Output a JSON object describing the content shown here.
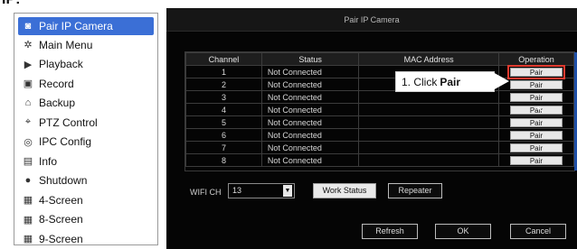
{
  "clipped_header": "IP:",
  "menu": {
    "items": [
      {
        "label": "Pair IP Camera",
        "icon": "camera-icon",
        "glyph": "◙",
        "active": true
      },
      {
        "label": "Main Menu",
        "icon": "gear-icon",
        "glyph": "✲",
        "active": false
      },
      {
        "label": "Playback",
        "icon": "playback-icon",
        "glyph": "▶",
        "active": false
      },
      {
        "label": "Record",
        "icon": "record-icon",
        "glyph": "▣",
        "active": false
      },
      {
        "label": "Backup",
        "icon": "backup-icon",
        "glyph": "⌂",
        "active": false
      },
      {
        "label": "PTZ Control",
        "icon": "ptz-icon",
        "glyph": "⌖",
        "active": false
      },
      {
        "label": "IPC Config",
        "icon": "ipc-config-icon",
        "glyph": "◎",
        "active": false
      },
      {
        "label": "Info",
        "icon": "info-icon",
        "glyph": "▤",
        "active": false
      },
      {
        "label": "Shutdown",
        "icon": "shutdown-icon",
        "glyph": "●",
        "active": false
      },
      {
        "label": "4-Screen",
        "icon": "grid-icon",
        "glyph": "▦",
        "active": false
      },
      {
        "label": "8-Screen",
        "icon": "grid-icon",
        "glyph": "▦",
        "active": false
      },
      {
        "label": "9-Screen",
        "icon": "grid-icon",
        "glyph": "▦",
        "active": false
      }
    ]
  },
  "dialog": {
    "title": "Pair IP Camera",
    "columns": [
      "Channel",
      "Status",
      "MAC Address",
      "Operation"
    ],
    "rows": [
      {
        "channel": "1",
        "status": "Not Connected",
        "mac": "",
        "op": "Pair"
      },
      {
        "channel": "2",
        "status": "Not Connected",
        "mac": "",
        "op": "Pair"
      },
      {
        "channel": "3",
        "status": "Not Connected",
        "mac": "",
        "op": "Pair"
      },
      {
        "channel": "4",
        "status": "Not Connected",
        "mac": "",
        "op": "Pair"
      },
      {
        "channel": "5",
        "status": "Not Connected",
        "mac": "",
        "op": "Pair"
      },
      {
        "channel": "6",
        "status": "Not Connected",
        "mac": "",
        "op": "Pair"
      },
      {
        "channel": "7",
        "status": "Not Connected",
        "mac": "",
        "op": "Pair"
      },
      {
        "channel": "8",
        "status": "Not Connected",
        "mac": "",
        "op": "Pair"
      }
    ],
    "wifi_label": "WIFI CH",
    "wifi_value": "13",
    "work_status": "Work Status",
    "repeater": "Repeater",
    "refresh": "Refresh",
    "ok": "OK",
    "cancel": "Cancel"
  },
  "callout": {
    "prefix": "1. Click",
    "bold": "Pair"
  },
  "colors": {
    "highlight": "#e03a2f",
    "active_menu": "#3b6fd6"
  }
}
